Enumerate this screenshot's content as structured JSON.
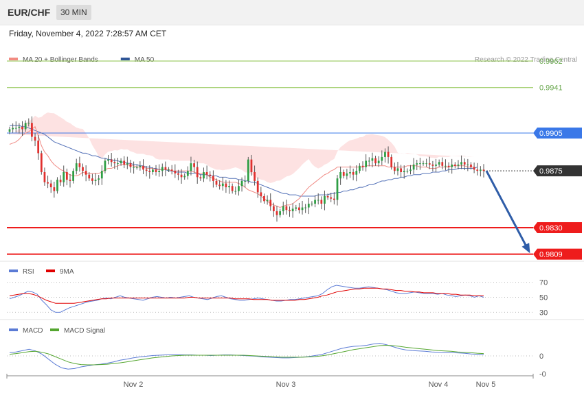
{
  "header": {
    "symbol": "EUR/CHF",
    "timeframe": "30 MIN",
    "datetime": "Friday, November 4, 2022 7:28:57 AM CET"
  },
  "legends": {
    "price": [
      {
        "label": "MA 20 + Bollinger Bands",
        "color": "#f28b82"
      },
      {
        "label": "MA 50",
        "color": "#2f5597"
      }
    ],
    "rsi": [
      {
        "label": "RSI",
        "color": "#5b7bd5"
      },
      {
        "label": "9MA",
        "color": "#e00000"
      }
    ],
    "macd": [
      {
        "label": "MACD",
        "color": "#5b7bd5"
      },
      {
        "label": "MACD Signal",
        "color": "#55a630"
      }
    ]
  },
  "copyright": "Research © 2022 Trading Central",
  "colors": {
    "bull": "#2e9e44",
    "bear": "#e0302e",
    "band_fill": "#fde2e2",
    "ma20": "#f08a84",
    "ma50": "#5472b8",
    "resistance": "#3a78e8",
    "support": "#ee1c1c",
    "target_green": "#8bc34a",
    "arrow": "#2f5da8",
    "current": "#333333"
  },
  "chart_data": [
    {
      "type": "candlestick",
      "title": "",
      "x_ticks": [
        "Nov 2",
        "Nov 3",
        "Nov 4",
        "Nov 5"
      ],
      "ylim": [
        0.9805,
        0.9968
      ],
      "levels": [
        {
          "value": 0.9962,
          "label": "0.9962",
          "kind": "target"
        },
        {
          "value": 0.9941,
          "label": "0.9941",
          "kind": "target"
        },
        {
          "value": 0.9905,
          "label": "0.9905",
          "kind": "resistance"
        },
        {
          "value": 0.9875,
          "label": "0.9875",
          "kind": "current"
        },
        {
          "value": 0.983,
          "label": "0.9830",
          "kind": "support"
        },
        {
          "value": 0.9809,
          "label": "0.9809",
          "kind": "support"
        }
      ],
      "forecast_arrow": {
        "from": 0.9875,
        "to": 0.9809
      },
      "closes": [
        0.9908,
        0.9909,
        0.9909,
        0.991,
        0.9908,
        0.9913,
        0.9913,
        0.9902,
        0.9899,
        0.9889,
        0.9874,
        0.9866,
        0.9865,
        0.9862,
        0.9859,
        0.9868,
        0.9866,
        0.9874,
        0.9868,
        0.9867,
        0.9875,
        0.9881,
        0.9878,
        0.9875,
        0.9872,
        0.9869,
        0.9867,
        0.9868,
        0.9869,
        0.9875,
        0.9883,
        0.9884,
        0.9882,
        0.9881,
        0.9881,
        0.9883,
        0.988,
        0.9881,
        0.9878,
        0.9878,
        0.9878,
        0.9879,
        0.9876,
        0.9875,
        0.9874,
        0.9876,
        0.9874,
        0.9875,
        0.9878,
        0.9876,
        0.9876,
        0.9875,
        0.9873,
        0.9872,
        0.987,
        0.9871,
        0.9875,
        0.9881,
        0.9878,
        0.987,
        0.9869,
        0.9874,
        0.9872,
        0.9871,
        0.9867,
        0.9864,
        0.9863,
        0.9865,
        0.9862,
        0.9863,
        0.9859,
        0.9859,
        0.9863,
        0.9867,
        0.9867,
        0.9884,
        0.9874,
        0.9867,
        0.9858,
        0.9855,
        0.9851,
        0.9852,
        0.9847,
        0.9843,
        0.984,
        0.9843,
        0.9847,
        0.9844,
        0.9843,
        0.9845,
        0.9846,
        0.9844,
        0.9846,
        0.9846,
        0.9849,
        0.9849,
        0.9852,
        0.9852,
        0.9849,
        0.9855,
        0.9854,
        0.9853,
        0.9852,
        0.9869,
        0.9874,
        0.9871,
        0.9873,
        0.9874,
        0.9872,
        0.9875,
        0.9879,
        0.9878,
        0.9883,
        0.9883,
        0.9885,
        0.9881,
        0.9883,
        0.9886,
        0.989,
        0.9886,
        0.9878,
        0.9875,
        0.9877,
        0.9874,
        0.9875,
        0.9875,
        0.9876,
        0.988,
        0.9881,
        0.9881,
        0.9881,
        0.9881,
        0.988,
        0.9879,
        0.988,
        0.9882,
        0.9879,
        0.9879,
        0.9878,
        0.988,
        0.9879,
        0.988,
        0.9882,
        0.988,
        0.988,
        0.9878,
        0.9876,
        0.9875,
        0.9876,
        0.9875
      ],
      "ma20": [
        0.9896,
        0.9897,
        0.9898,
        0.99,
        0.9903,
        0.9905,
        0.9906,
        0.9908,
        0.991,
        0.9903,
        0.9895,
        0.989,
        0.9887,
        0.9883,
        0.988,
        0.9878,
        0.9876,
        0.9875,
        0.9873,
        0.9872,
        0.9871,
        0.9871,
        0.9872,
        0.9874,
        0.9873,
        0.9873,
        0.9873,
        0.9873,
        0.9873,
        0.9874,
        0.9876,
        0.9877,
        0.9877,
        0.9878,
        0.9879,
        0.988,
        0.988,
        0.988,
        0.9879,
        0.9879,
        0.9878,
        0.9878,
        0.9878,
        0.9877,
        0.9877,
        0.9877,
        0.9876,
        0.9876,
        0.9876,
        0.9876,
        0.9876,
        0.9875,
        0.9875,
        0.9875,
        0.9875,
        0.9875,
        0.9875,
        0.9875,
        0.9874,
        0.9873,
        0.9873,
        0.9873,
        0.9872,
        0.987,
        0.9869,
        0.9868,
        0.9867,
        0.9866,
        0.9866,
        0.9866,
        0.9866,
        0.9866,
        0.9865,
        0.9864,
        0.9862,
        0.986,
        0.9859,
        0.9858,
        0.9857,
        0.9855,
        0.9853,
        0.9851,
        0.9849,
        0.9848,
        0.9847,
        0.9846,
        0.9847,
        0.9848,
        0.9848,
        0.9849,
        0.9851,
        0.9853,
        0.9856,
        0.9859,
        0.9862,
        0.9864,
        0.9866,
        0.9868,
        0.987,
        0.9872,
        0.9873,
        0.9875,
        0.9876,
        0.9878,
        0.9878,
        0.9878,
        0.9878,
        0.9878,
        0.9878,
        0.9878,
        0.9878,
        0.9878,
        0.9879,
        0.9879,
        0.9879,
        0.9879,
        0.9879,
        0.9879,
        0.9879,
        0.9878,
        0.9878,
        0.9878,
        0.9878,
        0.9878,
        0.9878,
        0.9879,
        0.9879,
        0.9879,
        0.9879,
        0.9878,
        0.9878,
        0.9878,
        0.9877,
        0.9877,
        0.9877,
        0.9878,
        0.9878,
        0.9878,
        0.9878,
        0.9879,
        0.9879,
        0.9879,
        0.9879,
        0.9879,
        0.9878,
        0.9878,
        0.9878
      ],
      "ma50": [
        0.9911,
        0.9911,
        0.9911,
        0.9911,
        0.991,
        0.991,
        0.9909,
        0.9908,
        0.9907,
        0.9906,
        0.9905,
        0.9904,
        0.9902,
        0.99,
        0.9898,
        0.9897,
        0.9896,
        0.9895,
        0.9894,
        0.9893,
        0.9892,
        0.9891,
        0.989,
        0.9889,
        0.9889,
        0.9888,
        0.9887,
        0.9887,
        0.9886,
        0.9885,
        0.9885,
        0.9884,
        0.9884,
        0.9883,
        0.9883,
        0.9882,
        0.9882,
        0.9881,
        0.9881,
        0.988,
        0.988,
        0.9879,
        0.9879,
        0.9878,
        0.9878,
        0.9877,
        0.9877,
        0.9876,
        0.9876,
        0.9876,
        0.9875,
        0.9875,
        0.9874,
        0.9874,
        0.9874,
        0.9874,
        0.9873,
        0.9873,
        0.9873,
        0.9873,
        0.9872,
        0.9872,
        0.9872,
        0.9871,
        0.9871,
        0.9871,
        0.987,
        0.987,
        0.987,
        0.9869,
        0.9869,
        0.9869,
        0.9868,
        0.9868,
        0.9867,
        0.9867,
        0.9866,
        0.9866,
        0.9865,
        0.9864,
        0.9863,
        0.9862,
        0.9861,
        0.986,
        0.9859,
        0.9858,
        0.9857,
        0.9857,
        0.9856,
        0.9856,
        0.9856,
        0.9855,
        0.9855,
        0.9855,
        0.9855,
        0.9855,
        0.9855,
        0.9856,
        0.9856,
        0.9856,
        0.9856,
        0.9857,
        0.9857,
        0.9858,
        0.9858,
        0.9859,
        0.9859,
        0.986,
        0.986,
        0.9861,
        0.9862,
        0.9862,
        0.9863,
        0.9864,
        0.9864,
        0.9865,
        0.9866,
        0.9867,
        0.9867,
        0.9868,
        0.9868,
        0.9869,
        0.9869,
        0.987,
        0.987,
        0.9871,
        0.9871,
        0.9872,
        0.9872,
        0.9872,
        0.9873,
        0.9873,
        0.9873,
        0.9874,
        0.9874,
        0.9874,
        0.9875,
        0.9875,
        0.9876,
        0.9876,
        0.9876,
        0.9877,
        0.9877,
        0.9877,
        0.9877,
        0.9877,
        0.9877,
        0.9878
      ]
    },
    {
      "type": "line",
      "title": "RSI",
      "y_ticks": [
        "70",
        "50",
        "30"
      ],
      "ylim": [
        24,
        76
      ],
      "series": [
        {
          "name": "RSI",
          "values": [
            48,
            50,
            52,
            55,
            58,
            57,
            54,
            46,
            40,
            33,
            30,
            30,
            33,
            36,
            38,
            40,
            42,
            44,
            45,
            46,
            48,
            49,
            48,
            50,
            52,
            50,
            49,
            48,
            47,
            46,
            48,
            50,
            51,
            50,
            49,
            50,
            49,
            50,
            51,
            52,
            50,
            49,
            48,
            47,
            49,
            51,
            52,
            50,
            48,
            47,
            46,
            46,
            47,
            48,
            49,
            48,
            47,
            46,
            45,
            45,
            46,
            47,
            47,
            48,
            49,
            50,
            51,
            52,
            55,
            60,
            64,
            66,
            65,
            64,
            63,
            62,
            62,
            63,
            64,
            63,
            62,
            61,
            60,
            58,
            56,
            55,
            55,
            56,
            57,
            56,
            55,
            55,
            55,
            54,
            55,
            53,
            52,
            51,
            52,
            53,
            52,
            50,
            52,
            50
          ]
        },
        {
          "name": "9MA",
          "values": [
            52,
            53,
            54,
            55,
            55,
            54,
            52,
            49,
            46,
            44,
            42,
            42,
            42,
            42,
            42,
            43,
            44,
            45,
            46,
            47,
            48,
            48,
            49,
            49,
            49,
            49,
            49,
            49,
            49,
            49,
            49,
            49,
            49,
            49,
            49,
            49,
            49,
            49,
            49,
            50,
            50,
            49,
            49,
            49,
            49,
            49,
            49,
            49,
            49,
            48,
            48,
            48,
            48,
            47,
            47,
            47,
            47,
            46,
            46,
            46,
            46,
            46,
            46,
            47,
            47,
            48,
            49,
            50,
            52,
            53,
            55,
            57,
            58,
            59,
            60,
            61,
            61,
            62,
            62,
            62,
            62,
            61,
            61,
            60,
            59,
            59,
            58,
            58,
            57,
            57,
            56,
            56,
            56,
            55,
            55,
            55,
            54,
            54,
            53,
            53,
            53,
            52,
            52,
            52
          ]
        }
      ]
    },
    {
      "type": "line",
      "title": "MACD",
      "y_ticks": [
        "0",
        "-0"
      ],
      "ylim": [
        -0.0006,
        0.0006
      ],
      "series": [
        {
          "name": "MACD",
          "values": [
            0.0001,
            0.00012,
            0.00016,
            0.0002,
            0.00015,
            5e-05,
            -0.0001,
            -0.00025,
            -0.00036,
            -0.0004,
            -0.00038,
            -0.00033,
            -0.0003,
            -0.00027,
            -0.00025,
            -0.00022,
            -0.00018,
            -0.00013,
            -0.0001,
            -6e-05,
            -3e-05,
            -1e-05,
            1e-05,
            2e-05,
            3e-05,
            4e-05,
            4e-05,
            3e-05,
            3e-05,
            2e-05,
            2e-05,
            1e-05,
            2e-05,
            3e-05,
            3e-05,
            2e-05,
            1e-05,
            0.0,
            -1e-05,
            -3e-05,
            -4e-05,
            -5e-05,
            -6e-05,
            -6e-05,
            -5e-05,
            -4e-05,
            -2e-05,
            1e-05,
            4e-05,
            0.0001,
            0.00016,
            0.00022,
            0.00026,
            0.00029,
            0.0003,
            0.00032,
            0.00036,
            0.00038,
            0.00034,
            0.00028,
            0.00022,
            0.00018,
            0.00016,
            0.00015,
            0.00014,
            0.00012,
            0.00011,
            0.0001,
            0.0001,
            9e-05,
            8e-05,
            6e-05,
            5e-05,
            4e-05
          ]
        },
        {
          "name": "MACD Signal",
          "values": [
            5e-05,
            7e-05,
            0.0001,
            0.00013,
            0.00014,
            0.00011,
            6e-05,
            -2e-05,
            -0.0001,
            -0.00018,
            -0.00023,
            -0.00026,
            -0.00027,
            -0.00027,
            -0.00026,
            -0.00025,
            -0.00023,
            -0.00021,
            -0.00018,
            -0.00015,
            -0.00012,
            -9e-05,
            -6e-05,
            -4e-05,
            -2e-05,
            0.0,
            1e-05,
            2e-05,
            2e-05,
            2e-05,
            2e-05,
            2e-05,
            2e-05,
            2e-05,
            2e-05,
            2e-05,
            2e-05,
            1e-05,
            0.0,
            -1e-05,
            -2e-05,
            -3e-05,
            -4e-05,
            -4e-05,
            -4e-05,
            -4e-05,
            -3e-05,
            -2e-05,
            0.0,
            3e-05,
            7e-05,
            0.00011,
            0.00015,
            0.00019,
            0.00022,
            0.00025,
            0.00028,
            0.00031,
            0.00032,
            0.00031,
            0.00029,
            0.00026,
            0.00024,
            0.00022,
            0.0002,
            0.00018,
            0.00016,
            0.00015,
            0.00014,
            0.00012,
            0.00011,
            0.0001,
            8e-05,
            7e-05
          ]
        }
      ]
    }
  ]
}
